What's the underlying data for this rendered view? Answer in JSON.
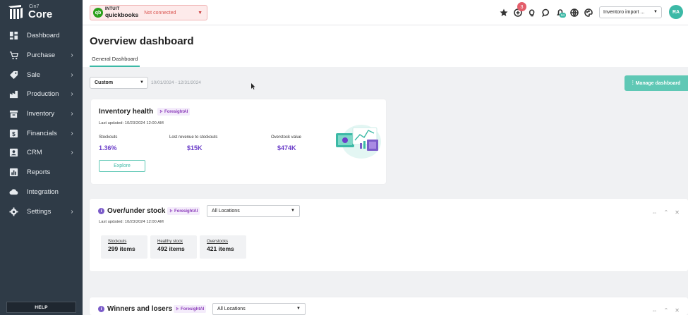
{
  "brand": {
    "small": "Cin7",
    "big": "Core"
  },
  "sidebar": {
    "items": [
      {
        "label": "Dashboard",
        "icon": "dashboard-icon",
        "chevron": false
      },
      {
        "label": "Purchase",
        "icon": "cart-icon",
        "chevron": true
      },
      {
        "label": "Sale",
        "icon": "tag-icon",
        "chevron": true
      },
      {
        "label": "Production",
        "icon": "factory-icon",
        "chevron": true
      },
      {
        "label": "Inventory",
        "icon": "inventory-icon",
        "chevron": true
      },
      {
        "label": "Financials",
        "icon": "dollar-icon",
        "chevron": true
      },
      {
        "label": "CRM",
        "icon": "contact-icon",
        "chevron": true
      },
      {
        "label": "Reports",
        "icon": "reports-icon",
        "chevron": false
      },
      {
        "label": "Integration",
        "icon": "cloud-icon",
        "chevron": false
      },
      {
        "label": "Settings",
        "icon": "gear-icon",
        "chevron": true
      }
    ],
    "help_label": "HELP"
  },
  "topbar": {
    "quickbooks": {
      "brand_top": "INTUIT",
      "brand_bottom": "quickbooks",
      "status": "Not connected"
    },
    "notification_count": "3",
    "teal_badge": "94",
    "company": "Inventoro import ...",
    "avatar": "RA"
  },
  "header": {
    "title": "Overview dashboard",
    "tab": "General Dashboard"
  },
  "filters": {
    "period": "Custom",
    "date_range": "10/01/2024 - 12/31/2024",
    "manage_label": "Manage dashboard"
  },
  "inventory_health": {
    "title": "Inventory health",
    "foresight": "ForesightAI",
    "updated": "Last updated: 10/23/2024 12:00 AM",
    "kpis": [
      {
        "label": "Stockouts",
        "value": "1.36%"
      },
      {
        "label": "Lost revenue to stockouts",
        "value": "$15K"
      },
      {
        "label": "Overstock value",
        "value": "$474K"
      }
    ],
    "explore_label": "Explore"
  },
  "over_under": {
    "title": "Over/under stock",
    "foresight": "ForesightAI",
    "location": "All Locations",
    "updated": "Last updated: 10/23/2024 12:00 AM",
    "stats": [
      {
        "label": "Stockouts",
        "value": "299 items"
      },
      {
        "label": "Healthy stock",
        "value": "492 items"
      },
      {
        "label": "Overstocks",
        "value": "421 items"
      }
    ]
  },
  "winners": {
    "title": "Winners and losers",
    "foresight": "ForesightAI",
    "location": "All Locations"
  },
  "colors": {
    "sidebar": "#2f3b47",
    "accent": "#3cb9a6",
    "foresight": "#8a3ab9",
    "kpi": "#6c3fc9",
    "alert": "#e35d6a"
  }
}
